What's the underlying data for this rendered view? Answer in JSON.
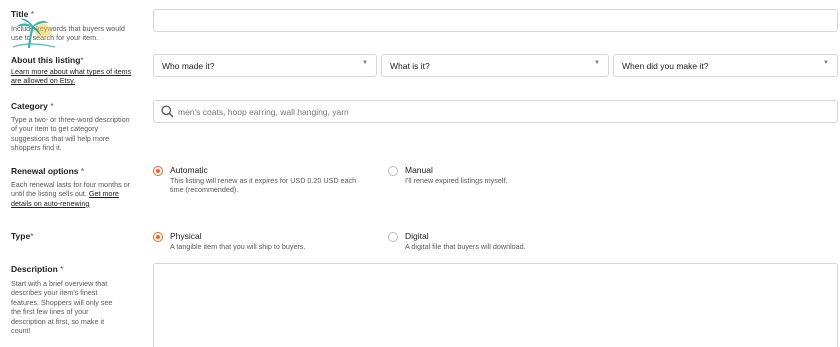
{
  "title_field": {
    "label": "Title",
    "required_mark": "*",
    "help": "Include keywords that buyers would use to search for your item.",
    "value": ""
  },
  "about": {
    "label": "About this listing",
    "required_mark": "*",
    "help_link": "Learn more about what types of items are allowed on Etsy.",
    "selects": [
      {
        "value": "Who made it?"
      },
      {
        "value": "What is it?"
      },
      {
        "value": "When did you make it?"
      }
    ]
  },
  "category": {
    "label": "Category",
    "required_mark": "*",
    "help": "Type a two- or three-word description of your item to get category suggestions that will help more shoppers find it.",
    "placeholder": "men's coats, hoop earring, wall hanging, yarn"
  },
  "renewal": {
    "label": "Renewal options",
    "required_mark": "*",
    "help": "Each renewal lasts for four months or until the listing sells out.",
    "help_link": "Get more details on auto-renewing",
    "options": [
      {
        "label": "Automatic",
        "desc": "This listing will renew as it expires for USD 0.20 USD each time (recommended).",
        "selected": true
      },
      {
        "label": "Manual",
        "desc": "I'll renew expired listings myself.",
        "selected": false
      }
    ]
  },
  "type": {
    "label": "Type",
    "required_mark": "*",
    "options": [
      {
        "label": "Physical",
        "desc": "A tangible item that you will ship to buyers.",
        "selected": true
      },
      {
        "label": "Digital",
        "desc": "A digital file that buyers will download.",
        "selected": false
      }
    ]
  },
  "description": {
    "label": "Description",
    "required_mark": "*",
    "help": "Start with a brief overview that describes your item's finest features. Shoppers will only see the first few lines of your description at first, so make it count!",
    "value": ""
  },
  "colors": {
    "accent": "#f1641e",
    "border": "#d6d6d6",
    "muted": "#595959"
  },
  "icons": {
    "watermark": "palm-tree-logo",
    "search": "search-icon",
    "dropdown": "chevron-down-icon"
  }
}
